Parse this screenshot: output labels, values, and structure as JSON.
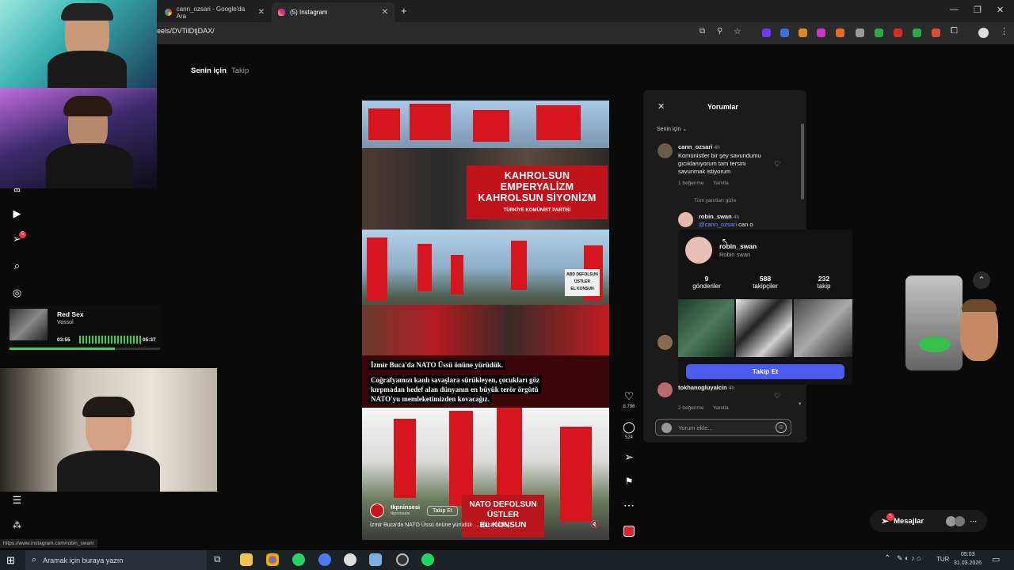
{
  "browser": {
    "tabs": [
      {
        "label": "cann_ozsari - Google'da Ara",
        "active": false
      },
      {
        "label": "(5) Instagram",
        "active": true
      }
    ],
    "url": "eels/DVTilDtjDAX/",
    "status_url": "https://www.instagram.com/robin_swan/"
  },
  "feed": {
    "tabs": [
      "Senin için",
      "Takip"
    ]
  },
  "nav": {
    "notification_count": "5"
  },
  "reel": {
    "banner_top": [
      "KAHROLSUN EMPERYALİZM",
      "KAHROLSUN SİYONİZM"
    ],
    "banner_sub": "TÜRKİYE KOMÜNİST PARTİSİ",
    "sign_mid": [
      "ABD DEFOLSUN",
      "ÜSTLER",
      "EL KONSUN"
    ],
    "caption_lines": [
      "İzmir Buca'da NATO Üssü önüne yürüdük.",
      "Coğrafyamızı kanlı savaşlara sürükleyen, çocukları göz",
      "kırpmadan hedef alan dünyanın en büyük terör örgütü",
      "NATO'yu memleketimizden kovacağız."
    ],
    "sign_bottom": [
      "NATO DEFOLSUN",
      "ÜSTLER",
      "EL KONSUN"
    ],
    "author": "tkpninsesi",
    "author_sub": "tkpninsesi",
    "follow_label": "Takip Et",
    "description": "İzmir Buca'da NATO Üssü önüne yürüdük. ... daha fazla"
  },
  "actions": {
    "likes": "8.796",
    "comments": "524"
  },
  "comments": {
    "title": "Yorumlar",
    "sort": "Senin için",
    "items": [
      {
        "user": "cann_ozsari",
        "time": "4h",
        "text": [
          "Komünistler bir şey savundumu",
          "gıcıklanıyorum tam tersini",
          "savunmak istiyorum"
        ],
        "likes": "1 beğenme",
        "reply": "Yanıtla"
      }
    ],
    "hide_replies": "Tüm yanıtları gizle",
    "reply": {
      "user": "robin_swan",
      "time": "4h",
      "mention": "@cann_ozsari",
      "text": "can o"
    },
    "last": {
      "user": "tokhanogluyalcin",
      "time": "4h",
      "likes": "2 beğenme",
      "reply": "Yanıtla"
    },
    "input_placeholder": "Yorum ekle..."
  },
  "profile_popup": {
    "username": "robin_swan",
    "full_name": "Robin swan",
    "stats": [
      {
        "value": "9",
        "label": "gönderiler"
      },
      {
        "value": "588",
        "label": "takipçiler"
      },
      {
        "value": "232",
        "label": "takip"
      }
    ],
    "follow": "Takip Et"
  },
  "music": {
    "title": "Red Sex",
    "artist": "Vossol",
    "elapsed": "03:55",
    "total": "05:37",
    "progress": 0.7
  },
  "messages": {
    "label": "Mesajlar",
    "badge": "5"
  },
  "taskbar": {
    "search_placeholder": "Aramak için buraya yazın",
    "lang": "TUR",
    "time": "05:03",
    "date": "31.03.2026"
  }
}
